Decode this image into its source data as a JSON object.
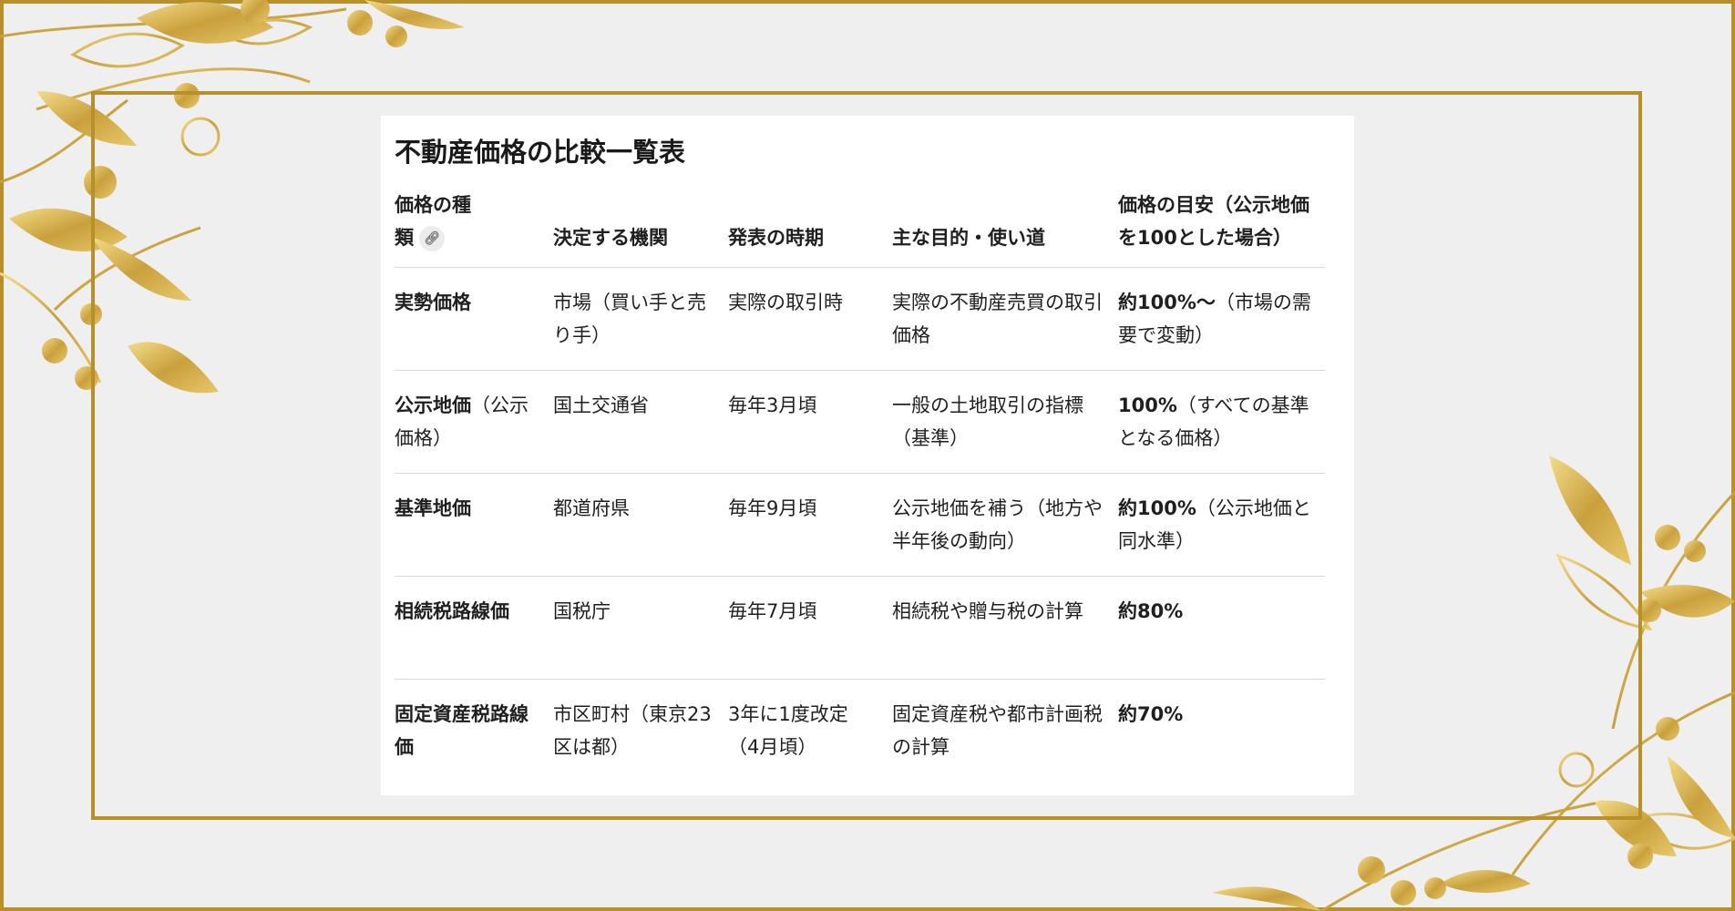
{
  "title": "不動産価格の比較一覧表",
  "table": {
    "headers": [
      "価格の種類",
      "決定する機関",
      "発表の時期",
      "主な目的・使い道",
      "価格の目安（公示地価を100とした場合）"
    ],
    "rows": [
      {
        "type": "実勢価格",
        "type_suffix": "",
        "agency": "市場（買い手と売り手）",
        "timing": "実際の取引時",
        "purpose": "実際の不動産売買の取引価格",
        "guide_bold": "約100%〜",
        "guide_rest": "（市場の需要で変動）"
      },
      {
        "type": "公示地価",
        "type_suffix": "（公示価格）",
        "agency": "国土交通省",
        "timing": "毎年3月頃",
        "purpose": "一般の土地取引の指標（基準）",
        "guide_bold": "100%",
        "guide_rest": "（すべての基準となる価格）"
      },
      {
        "type": "基準地価",
        "type_suffix": "",
        "agency": "都道府県",
        "timing": "毎年9月頃",
        "purpose": "公示地価を補う（地方や半年後の動向）",
        "guide_bold": "約100%",
        "guide_rest": "（公示地価と同水準）"
      },
      {
        "type": "相続税路線価",
        "type_suffix": "",
        "agency": "国税庁",
        "timing": "毎年7月頃",
        "purpose": "相続税や贈与税の計算",
        "guide_bold": "約80%",
        "guide_rest": ""
      },
      {
        "type": "固定資産税路線価",
        "type_suffix": "",
        "agency": "市区町村（東京23区は都）",
        "timing": "3年に1度改定（4月頃）",
        "purpose": "固定資産税や都市計画税の計算",
        "guide_bold": "約70%",
        "guide_rest": ""
      }
    ]
  },
  "icons": {
    "header_link": "link-icon"
  },
  "colors": {
    "gold": "#b8902a",
    "background": "#efefef"
  }
}
